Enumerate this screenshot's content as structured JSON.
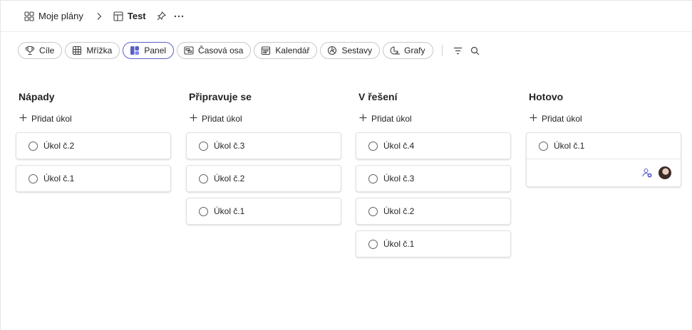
{
  "breadcrumb": {
    "parent_label": "Moje plány",
    "current_label": "Test",
    "icons": [
      "grid-apps-icon",
      "chevron-right-icon",
      "board-icon",
      "pin-icon",
      "more-icon"
    ]
  },
  "views": [
    {
      "label": "Cíle",
      "icon": "trophy-icon",
      "active": false
    },
    {
      "label": "Mřížka",
      "icon": "table-icon",
      "active": false
    },
    {
      "label": "Panel",
      "icon": "board-icon",
      "active": true
    },
    {
      "label": "Časová osa",
      "icon": "timeline-icon",
      "active": false
    },
    {
      "label": "Kalendář",
      "icon": "calendar-icon",
      "active": false
    },
    {
      "label": "Sestavy",
      "icon": "chart-icon",
      "active": false
    },
    {
      "label": "Grafy",
      "icon": "people-chart-icon",
      "active": false
    }
  ],
  "toolbar_icons": [
    "filter-icon",
    "search-icon"
  ],
  "accent_color": "#5b5fc7",
  "board": {
    "add_task_label": "Přidat úkol",
    "buckets": [
      {
        "title": "Nápady",
        "tasks": [
          "Úkol č.2",
          "Úkol č.1"
        ]
      },
      {
        "title": "Připravuje se",
        "tasks": [
          "Úkol č.3",
          "Úkol č.2",
          "Úkol č.1"
        ]
      },
      {
        "title": "V řešení",
        "tasks": [
          "Úkol č.4",
          "Úkol č.3",
          "Úkol č.2",
          "Úkol č.1"
        ]
      },
      {
        "title": "Hotovo",
        "tasks": [
          "Úkol č.1"
        ]
      }
    ]
  }
}
